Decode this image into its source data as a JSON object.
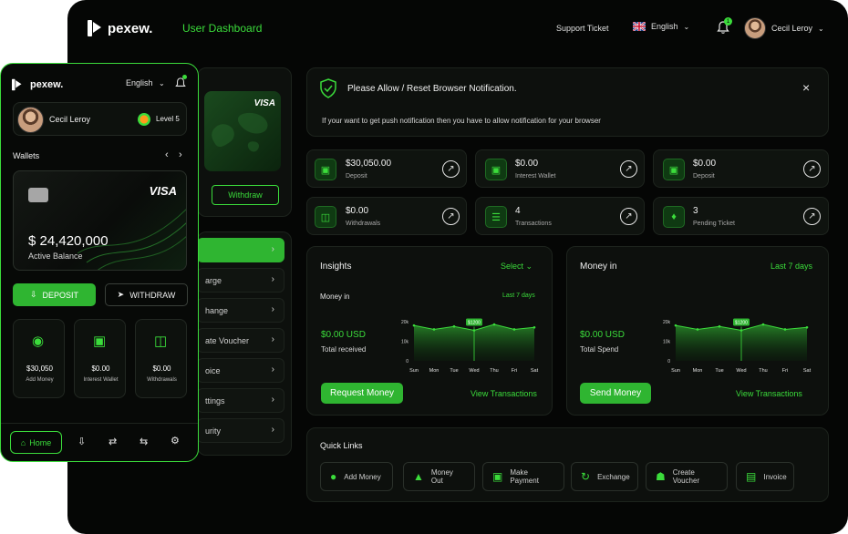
{
  "brand": {
    "name": "pexew."
  },
  "header": {
    "section_title": "User Dashboard",
    "support": "Support Ticket",
    "language": "English",
    "notif_count": "1",
    "user_name": "Cecil Leroy"
  },
  "desktop_card": {
    "brand": "VISA",
    "withdraw": "Withdraw"
  },
  "side_menu": [
    {
      "label": ""
    },
    {
      "label": "arge"
    },
    {
      "label": "hange"
    },
    {
      "label": "ate Voucher"
    },
    {
      "label": "oice"
    },
    {
      "label": "ttings"
    },
    {
      "label": "urity"
    }
  ],
  "notice": {
    "title": "Please Allow / Reset Browser Notification.",
    "body": "If your want to get push notification then you have to allow notification for your browser"
  },
  "stats": [
    {
      "value": "$30,050.00",
      "label": "Deposit",
      "icon": "wallet-icon"
    },
    {
      "value": "$0.00",
      "label": "Interest Wallet",
      "icon": "wallet-icon"
    },
    {
      "value": "$0.00",
      "label": "Deposit",
      "icon": "wallet-icon"
    },
    {
      "value": "$0.00",
      "label": "Withdrawals",
      "icon": "withdraw-icon"
    },
    {
      "value": "4",
      "label": "Transactions",
      "icon": "transactions-icon"
    },
    {
      "value": "3",
      "label": "Pending Ticket",
      "icon": "ticket-icon"
    }
  ],
  "insights": {
    "title": "Insights",
    "select": "Select",
    "sub": "Money in",
    "period": "Last 7 days",
    "amount": "$0.00 USD",
    "amount_label": "Total received",
    "button": "Request Money",
    "link": "View Transactions"
  },
  "money_in": {
    "title": "Money in",
    "period": "Last 7 days",
    "amount": "$0.00 USD",
    "amount_label": "Total Spend",
    "button": "Send Money",
    "link": "View Transactions"
  },
  "chart_data": [
    {
      "type": "area",
      "x": [
        "Sun",
        "Mon",
        "Tue",
        "Wed",
        "Thu",
        "Fri",
        "Sat"
      ],
      "y_ticks": [
        "20k",
        "10k",
        "0"
      ],
      "ylim": [
        0,
        25000
      ],
      "series": [
        {
          "values": [
            18000,
            16000,
            17500,
            15500,
            18500,
            16000,
            17000
          ]
        }
      ],
      "highlight": {
        "x": "Wed",
        "label": "$1200"
      }
    },
    {
      "type": "area",
      "x": [
        "Sun",
        "Mon",
        "Tue",
        "Wed",
        "Thu",
        "Fri",
        "Sat"
      ],
      "y_ticks": [
        "20k",
        "10k",
        "0"
      ],
      "ylim": [
        0,
        25000
      ],
      "series": [
        {
          "values": [
            18000,
            16000,
            17500,
            15500,
            18500,
            16000,
            17000
          ]
        }
      ],
      "highlight": {
        "x": "Wed",
        "label": "$1200"
      }
    }
  ],
  "quick_links": {
    "title": "Quick Links",
    "items": [
      {
        "label": "Add Money",
        "icon": "add-money-icon"
      },
      {
        "label": "Money Out",
        "icon": "money-out-icon"
      },
      {
        "label": "Make Payment",
        "icon": "payment-icon"
      },
      {
        "label": "Exchange",
        "icon": "exchange-icon"
      },
      {
        "label": "Create Voucher",
        "icon": "voucher-icon"
      },
      {
        "label": "Invoice",
        "icon": "invoice-icon"
      }
    ]
  },
  "mobile": {
    "brand": "pexew.",
    "language": "English",
    "user": "Cecil Leroy",
    "level": "Level 5",
    "wallets_title": "Wallets",
    "card_brand": "VISA",
    "balance": "$ 24,420,000",
    "balance_label": "Active Balance",
    "deposit": "DEPOSIT",
    "withdraw": "WITHDRAW",
    "tiles": [
      {
        "value": "$30,050",
        "label": "Add Money"
      },
      {
        "value": "$0.00",
        "label": "Interest Wallet"
      },
      {
        "value": "$0.00",
        "label": "Withdrawals"
      }
    ],
    "nav_home": "Home"
  }
}
